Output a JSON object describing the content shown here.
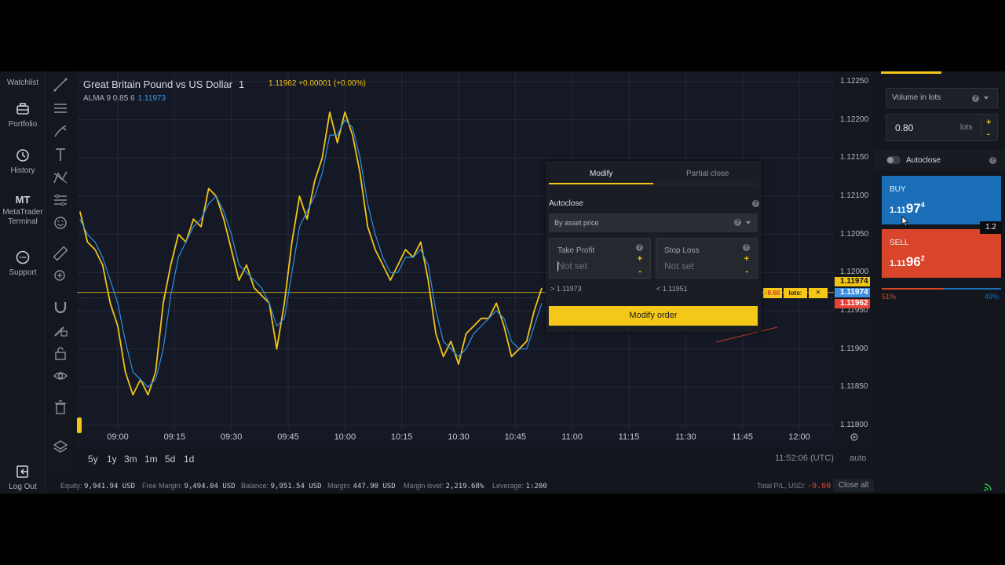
{
  "nav": {
    "watchlist": "Watchlist",
    "portfolio": "Portfolio",
    "history": "History",
    "mt_abbrev": "MT",
    "metatrader": "MetaTrader",
    "terminal": "Terminal",
    "support": "Support",
    "logout": "Log Out"
  },
  "tools": [
    "trend-line-icon",
    "horizontal-lines-icon",
    "brush-icon",
    "text-icon",
    "pattern-icon",
    "settings-lines-icon",
    "smiley-icon",
    "ruler-icon",
    "zoom-in-icon",
    "magnet-icon",
    "pencil-lock-icon",
    "lock-icon",
    "eye-icon",
    "trash-icon",
    "layers-icon"
  ],
  "chart": {
    "title": "Great Britain Pound vs US Dollar",
    "timeframe": "1",
    "quote": "1.11962 +0.00001 (+0.00%)",
    "indicator": "ALMA 9 0.85 6",
    "indicator_value": "1.11973",
    "price_tags": {
      "alma": "1.11974",
      "ask": "1.11974",
      "bid": "1.11962"
    },
    "colors": {
      "price": "#f2c418",
      "alma": "#2f8fe0",
      "grid": "#242a38",
      "ask_tag": "#3d8fe0",
      "bid_tag": "#e5433a",
      "price_tag": "#f2c418"
    }
  },
  "chart_data": {
    "type": "line",
    "title": "Great Britain Pound vs US Dollar",
    "x_ticks": [
      "09:00",
      "09:15",
      "09:30",
      "09:45",
      "10:00",
      "10:15",
      "10:30",
      "10:45",
      "11:00",
      "11:15",
      "11:30",
      "11:45",
      "12:00"
    ],
    "y_ticks": [
      "1.12250",
      "1.12200",
      "1.12150",
      "1.12100",
      "1.12050",
      "1.12000",
      "1.11950",
      "1.11900",
      "1.11850",
      "1.11800"
    ],
    "ylim": [
      1.118,
      1.1225
    ],
    "series": [
      {
        "name": "GBP/USD",
        "color": "#f2c418",
        "x": [
          "08:50",
          "08:52",
          "08:54",
          "08:56",
          "08:58",
          "09:00",
          "09:02",
          "09:04",
          "09:06",
          "09:08",
          "09:10",
          "09:12",
          "09:14",
          "09:16",
          "09:18",
          "09:20",
          "09:22",
          "09:24",
          "09:26",
          "09:28",
          "09:30",
          "09:32",
          "09:34",
          "09:36",
          "09:38",
          "09:40",
          "09:42",
          "09:44",
          "09:46",
          "09:48",
          "09:50",
          "09:52",
          "09:54",
          "09:56",
          "09:58",
          "10:00",
          "10:02",
          "10:04",
          "10:06",
          "10:08",
          "10:10",
          "10:12",
          "10:14",
          "10:16",
          "10:18",
          "10:20",
          "10:22",
          "10:24",
          "10:26",
          "10:28",
          "10:30",
          "10:32",
          "10:34",
          "10:36",
          "10:38",
          "10:40",
          "10:42",
          "10:44",
          "10:46",
          "10:48",
          "10:50",
          "10:52"
        ],
        "values": [
          1.1208,
          1.1204,
          1.1203,
          1.1201,
          1.1196,
          1.1193,
          1.1187,
          1.1184,
          1.1186,
          1.1184,
          1.1187,
          1.1196,
          1.1201,
          1.1205,
          1.1204,
          1.1207,
          1.1206,
          1.1211,
          1.121,
          1.1207,
          1.1203,
          1.1199,
          1.1201,
          1.1198,
          1.1197,
          1.1196,
          1.119,
          1.1196,
          1.1204,
          1.121,
          1.1207,
          1.1212,
          1.1215,
          1.1221,
          1.1217,
          1.1221,
          1.1218,
          1.1213,
          1.1206,
          1.1203,
          1.1201,
          1.1199,
          1.1201,
          1.1203,
          1.1202,
          1.1204,
          1.1199,
          1.1192,
          1.1189,
          1.1191,
          1.1188,
          1.1192,
          1.1193,
          1.1194,
          1.1194,
          1.1196,
          1.1193,
          1.1189,
          1.119,
          1.1191,
          1.1195,
          1.1198
        ]
      },
      {
        "name": "ALMA 9 0.85 6",
        "color": "#2f8fe0",
        "x": [
          "08:50",
          "08:52",
          "08:54",
          "08:56",
          "08:58",
          "09:00",
          "09:02",
          "09:04",
          "09:06",
          "09:08",
          "09:10",
          "09:12",
          "09:14",
          "09:16",
          "09:18",
          "09:20",
          "09:22",
          "09:24",
          "09:26",
          "09:28",
          "09:30",
          "09:32",
          "09:34",
          "09:36",
          "09:38",
          "09:40",
          "09:42",
          "09:44",
          "09:46",
          "09:48",
          "09:50",
          "09:52",
          "09:54",
          "09:56",
          "09:58",
          "10:00",
          "10:02",
          "10:04",
          "10:06",
          "10:08",
          "10:10",
          "10:12",
          "10:14",
          "10:16",
          "10:18",
          "10:20",
          "10:22",
          "10:24",
          "10:26",
          "10:28",
          "10:30",
          "10:32",
          "10:34",
          "10:36",
          "10:38",
          "10:40",
          "10:42",
          "10:44",
          "10:46",
          "10:48",
          "10:50",
          "10:52"
        ],
        "values": [
          1.1207,
          1.1205,
          1.1204,
          1.1202,
          1.1199,
          1.1196,
          1.1191,
          1.1187,
          1.1186,
          1.1185,
          1.1186,
          1.119,
          1.1197,
          1.1202,
          1.1204,
          1.1206,
          1.1207,
          1.1209,
          1.121,
          1.1208,
          1.1205,
          1.1201,
          1.12,
          1.1199,
          1.1198,
          1.1196,
          1.1193,
          1.1194,
          1.12,
          1.1206,
          1.1208,
          1.121,
          1.1213,
          1.1218,
          1.1218,
          1.122,
          1.1219,
          1.1215,
          1.1209,
          1.1205,
          1.1202,
          1.12,
          1.12,
          1.1202,
          1.1202,
          1.1203,
          1.1201,
          1.1195,
          1.1191,
          1.119,
          1.1189,
          1.119,
          1.1192,
          1.1193,
          1.1194,
          1.1195,
          1.1194,
          1.1191,
          1.119,
          1.119,
          1.1193,
          1.1196
        ]
      }
    ],
    "horizontal_line": 1.11974,
    "grid": true
  },
  "chart_footer": {
    "ranges": [
      "5y",
      "1y",
      "3m",
      "1m",
      "5d",
      "1d"
    ],
    "clock": "11:52:06 (UTC)",
    "scale": "auto"
  },
  "account": {
    "equity_label": "Equity:",
    "equity": "9,941.94 USD",
    "free_margin_label": "Free Margin:",
    "free_margin": "9,494.04 USD",
    "balance_label": "Balance:",
    "balance": "9,951.54 USD",
    "margin_label": "Margin:",
    "margin": "447.90 USD",
    "margin_level_label": "Margin level:",
    "margin_level": "2,219.68%",
    "leverage_label": "Leverage:",
    "leverage": "1:200",
    "total_pl_label": "Total P/L, USD:",
    "total_pl": "-9.60",
    "close_all": "Close all"
  },
  "modify": {
    "tab_modify": "Modify",
    "tab_partial": "Partial close",
    "autoclose": "Autoclose",
    "asset_price": "By asset price",
    "take_profit": "Take Profit",
    "stop_loss": "Stop Loss",
    "not_set": "Not set",
    "tp_hint": "> 1.11973",
    "sl_hint": "< 1.11951",
    "button": "Modify order"
  },
  "lot_marker": {
    "pl": "-9.60",
    "lots": "lots: 0.8",
    "close": "×"
  },
  "trade_panel": {
    "volume_mode": "Volume in lots",
    "volume": "0.80",
    "volume_unit": "lots",
    "autoclose": "Autoclose",
    "buy_label": "BUY",
    "buy_price_small": "1.11",
    "buy_price_big": "97",
    "buy_price_sup": "4",
    "sell_label": "SELL",
    "sell_price_small": "1.11",
    "sell_price_big": "96",
    "sell_price_sup": "2",
    "spread": "1.2",
    "sell_pct": "51%",
    "buy_pct": "49%",
    "sell_fraction": 0.51
  }
}
